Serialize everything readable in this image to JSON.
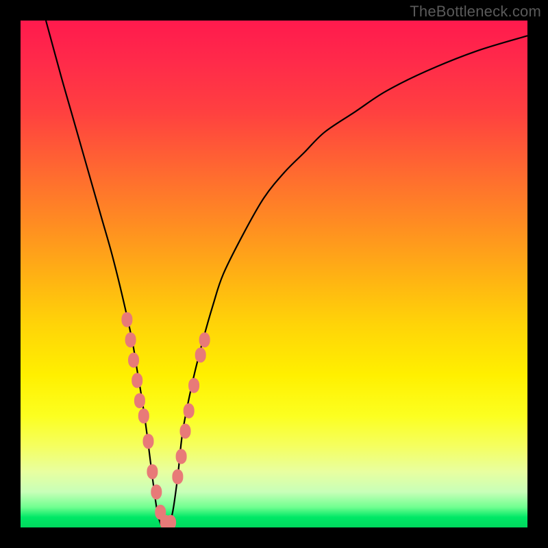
{
  "watermark": "TheBottleneck.com",
  "chart_data": {
    "type": "line",
    "title": "",
    "xlabel": "",
    "ylabel": "",
    "xlim": [
      0,
      100
    ],
    "ylim": [
      0,
      100
    ],
    "x": [
      5,
      8,
      10,
      12,
      14,
      16,
      18,
      20,
      22,
      23,
      24,
      25,
      26,
      27,
      28,
      29,
      30,
      31,
      32,
      34,
      36,
      38,
      40,
      44,
      48,
      52,
      56,
      60,
      66,
      72,
      80,
      90,
      100
    ],
    "values": [
      100,
      89,
      82,
      75,
      68,
      61,
      54,
      46,
      37,
      31,
      25,
      18,
      10,
      3,
      0,
      0,
      3,
      10,
      19,
      29,
      37,
      44,
      50,
      58,
      65,
      70,
      74,
      78,
      82,
      86,
      90,
      94,
      97
    ],
    "markers_x": [
      21.0,
      21.7,
      22.3,
      23.0,
      23.5,
      24.3,
      25.2,
      26.0,
      26.8,
      27.6,
      28.6,
      29.6,
      31.0,
      31.7,
      32.5,
      33.2,
      34.2,
      35.5,
      36.3
    ],
    "markers_y": [
      41,
      37,
      33,
      29,
      25,
      22,
      17,
      11,
      7,
      3,
      1,
      1,
      10,
      14,
      19,
      23,
      28,
      34,
      37
    ],
    "gradient_stops": [
      {
        "pos": 0,
        "color": "#ff1a4d"
      },
      {
        "pos": 50,
        "color": "#ffb014"
      },
      {
        "pos": 78,
        "color": "#fcff20"
      },
      {
        "pos": 100,
        "color": "#00d85e"
      }
    ],
    "series": [
      {
        "name": "bottleneck-curve",
        "kind": "line"
      },
      {
        "name": "curve-markers",
        "kind": "scatter"
      }
    ]
  }
}
